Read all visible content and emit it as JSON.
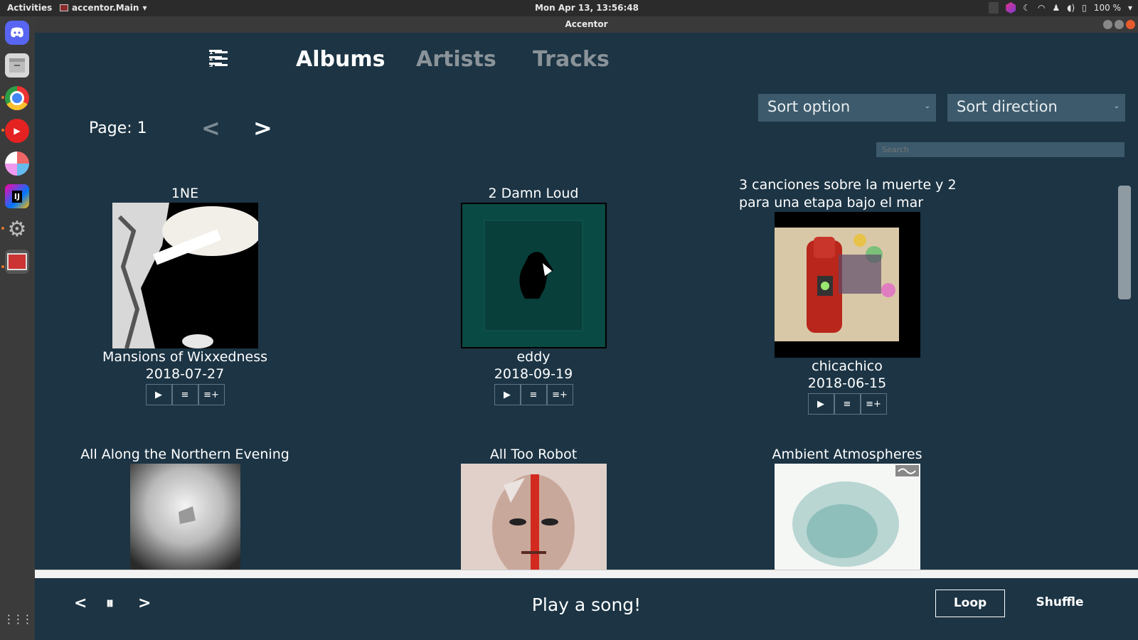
{
  "system": {
    "activities": "Activities",
    "app_menu": "accentor.Main",
    "clock": "Mon Apr 13, 13:56:48",
    "battery": "100 %"
  },
  "window": {
    "title": "Accentor"
  },
  "nav": {
    "tabs": [
      {
        "label": "Albums",
        "active": true
      },
      {
        "label": "Artists",
        "active": false
      },
      {
        "label": "Tracks",
        "active": false
      }
    ]
  },
  "controls": {
    "sort_option": "Sort option",
    "sort_direction": "Sort direction",
    "search_placeholder": "Search",
    "page_label": "Page: 1",
    "prev": "<",
    "next": ">"
  },
  "albums": [
    {
      "title": "1NE",
      "artist": "Mansions of Wixxedness",
      "date": "2018-07-27"
    },
    {
      "title": "2 Damn Loud",
      "artist": "eddy",
      "date": "2018-09-19"
    },
    {
      "title": "3 canciones sobre la muerte y 2 para una etapa bajo el mar",
      "artist": "chicachico",
      "date": "2018-06-15"
    },
    {
      "title": "All Along the Northern Evening",
      "artist": "",
      "date": ""
    },
    {
      "title": "All Too Robot",
      "artist": "",
      "date": ""
    },
    {
      "title": "Ambient Atmospheres",
      "artist": "",
      "date": ""
    }
  ],
  "album_actions": {
    "play": "▶",
    "queue": "≡",
    "add": "≡+"
  },
  "player": {
    "prev": "<",
    "pause": "⏸",
    "next": ">",
    "now_playing": "Play a song!",
    "loop": "Loop",
    "shuffle": "Shuffle"
  },
  "colors": {
    "background": "#1c3444",
    "control": "#3c5a6b",
    "accent_text": "#ffffff",
    "muted_text": "#8a9399"
  }
}
